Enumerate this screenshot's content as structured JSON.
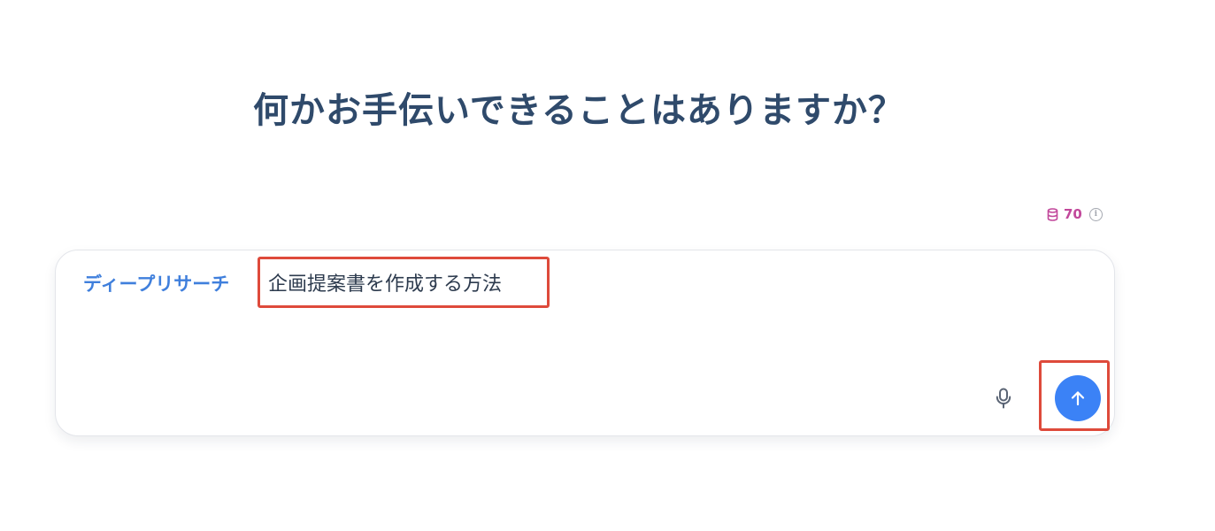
{
  "headline": "何かお手伝いできることはありますか？",
  "credits": {
    "value": "70",
    "icon": "database-icon",
    "info_icon": "info-icon",
    "info_glyph": "i",
    "color": "#c2489b"
  },
  "composer": {
    "mode_label": "ディープリサーチ",
    "query_text": "企画提案書を作成する方法",
    "mic_icon": "microphone-icon",
    "send_icon": "arrow-up-icon",
    "accent_color": "#3b82f6",
    "highlight_color": "#de4a3b"
  }
}
